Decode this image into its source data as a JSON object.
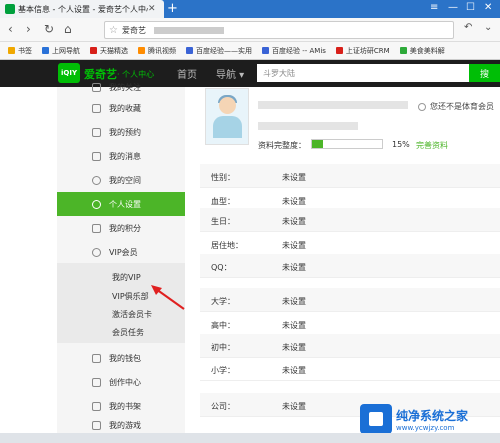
{
  "browser": {
    "tab_title": "基本信息 - 个人设置 - 爱奇艺个人中心",
    "new_tab": "+",
    "url_site": "爱奇艺",
    "bookmarks": [
      "书签",
      "上网导航",
      "天猫精选",
      "腾讯视频",
      "百度经验——实用",
      "百度经验 -- AMis",
      "上证坊研CRM",
      "美食美料解"
    ]
  },
  "site_header": {
    "logo": "iQIY",
    "brand": "爱奇艺",
    "brand_sub": "· 个人中心",
    "nav": [
      "首页",
      "导航 ▾"
    ],
    "search_placeholder": "斗罗大陆",
    "search_button": "搜"
  },
  "sidebar": {
    "items": [
      {
        "label": "我的关注"
      },
      {
        "label": "我的收藏"
      },
      {
        "label": "我的预约"
      },
      {
        "label": "我的消息"
      },
      {
        "label": "我的空间"
      },
      {
        "label": "个人设置"
      },
      {
        "label": "我的积分"
      },
      {
        "label": "VIP会员"
      }
    ],
    "vip_sub": [
      "我的VIP",
      "VIP俱乐部",
      "激活会员卡",
      "会员任务"
    ],
    "bottom_items": [
      {
        "label": "我的钱包"
      },
      {
        "label": "创作中心"
      },
      {
        "label": "我的书架"
      },
      {
        "label": "我的游戏"
      }
    ]
  },
  "profile": {
    "not_vip": "您还不是体育会员",
    "completeness_label": "资料完整度：",
    "completeness_pct": "15%",
    "completeness_value": 0.15,
    "complete_link": "完善资料"
  },
  "fields": [
    {
      "label": "性别：",
      "value": "未设置"
    },
    {
      "label": "血型：",
      "value": "未设置"
    },
    {
      "label": "生日：",
      "value": "未设置"
    },
    {
      "label": "居住地：",
      "value": "未设置"
    },
    {
      "label": "QQ：",
      "value": "未设置"
    },
    {
      "label": "大学：",
      "value": "未设置"
    },
    {
      "label": "高中：",
      "value": "未设置"
    },
    {
      "label": "初中：",
      "value": "未设置"
    },
    {
      "label": "小学：",
      "value": "未设置"
    },
    {
      "label": "公司：",
      "value": "未设置"
    }
  ],
  "watermark": {
    "title": "纯净系统之家",
    "url": "www.ycwjzy.com"
  },
  "colors": {
    "accent": "#4cb528",
    "header_bg": "#1d1d1d",
    "browser_tabbar": "#2b73c8"
  }
}
